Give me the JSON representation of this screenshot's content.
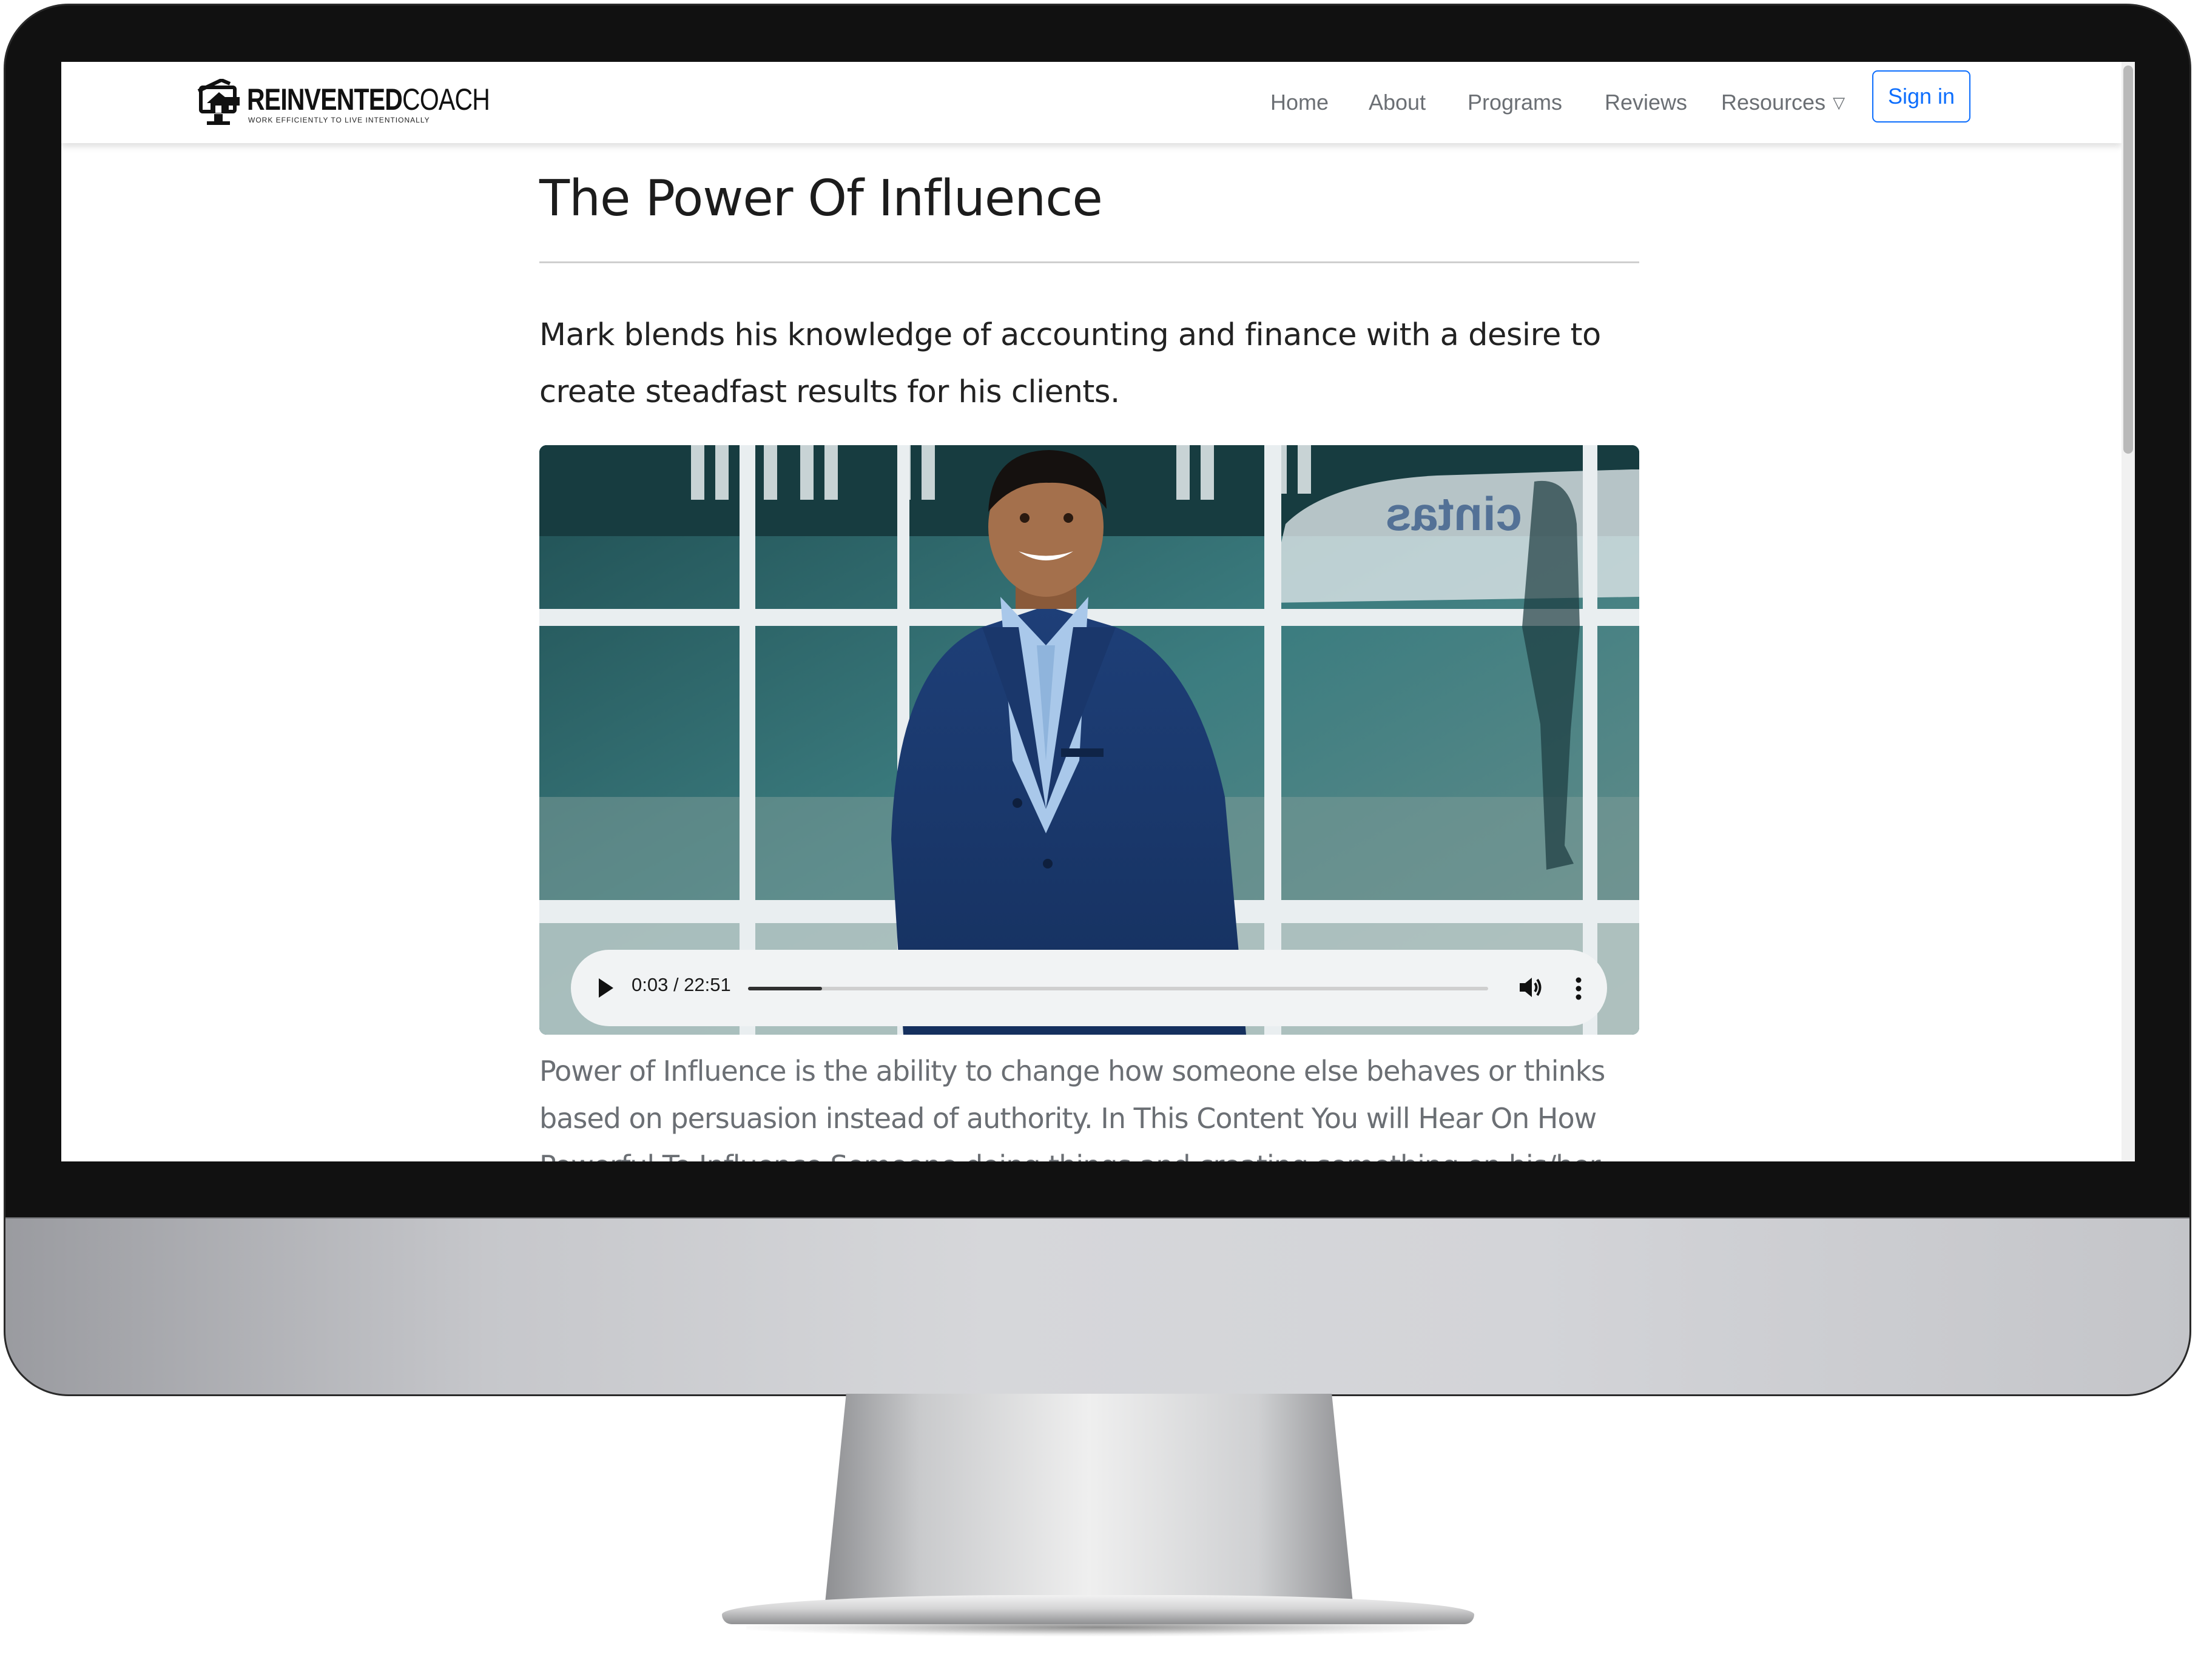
{
  "header": {
    "logo_text": "REINVENTEDCOACH",
    "logo_text_bold": "REINVENTED",
    "logo_text_light": "COACH",
    "logo_tagline": "WORK EFFICIENTLY TO LIVE INTENTIONALLY",
    "nav": [
      {
        "label": "Home"
      },
      {
        "label": "About"
      },
      {
        "label": "Programs"
      },
      {
        "label": "Reviews"
      },
      {
        "label": "Resources"
      }
    ],
    "resources_icon": "chevron-down-icon",
    "signin_label": "Sign in"
  },
  "main": {
    "title": "The Power Of Influence",
    "lead": "Mark blends his knowledge of accounting and finance with a desire to create steadfast results for his clients.",
    "photo_storefront_text": "cintas",
    "audio": {
      "time": "0:03 / 22:51",
      "progress_fraction": 0.1,
      "play_icon": "play-icon",
      "volume_icon": "volume-icon",
      "more_icon": "more-vertical-icon"
    },
    "body": "Power of Influence is the ability to change how someone else behaves or thinks based on persuasion instead of authority. In This Content You will Hear On How Powerful To Influence Someone doing things and creating something on his/her behalf."
  },
  "colors": {
    "link_blue": "#0d6efd",
    "nav_text": "#6b6f74",
    "audio_bar": "#f1f3f4"
  }
}
